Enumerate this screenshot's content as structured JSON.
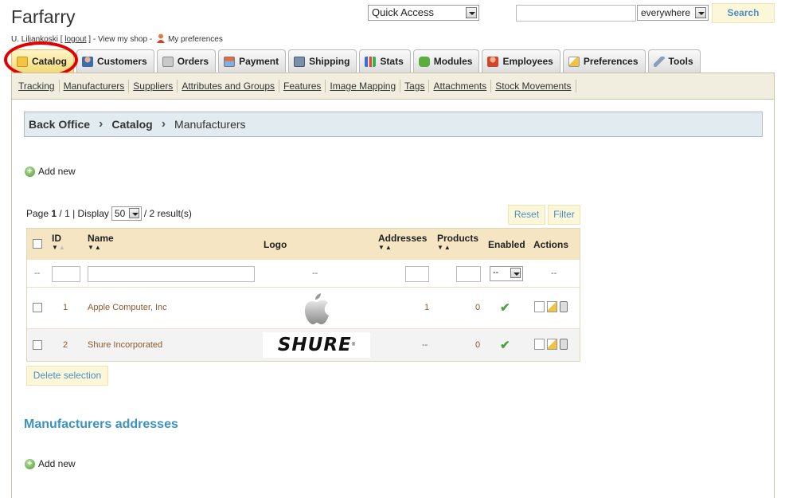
{
  "header": {
    "shop_name": "Farfarry",
    "user": "U. Liljankoski",
    "logout": "logout",
    "view_shop": "View my shop",
    "my_preferences": "My preferences",
    "quick_access": "Quick Access",
    "search_scope": "everywhere",
    "search_label": "Search"
  },
  "tabs": [
    {
      "label": "Catalog",
      "icon": "folder-icon",
      "active": true
    },
    {
      "label": "Customers",
      "icon": "customer-icon"
    },
    {
      "label": "Orders",
      "icon": "cart-icon"
    },
    {
      "label": "Payment",
      "icon": "payment-icon"
    },
    {
      "label": "Shipping",
      "icon": "truck-icon"
    },
    {
      "label": "Stats",
      "icon": "chart-icon"
    },
    {
      "label": "Modules",
      "icon": "puzzle-icon"
    },
    {
      "label": "Employees",
      "icon": "employee-icon"
    },
    {
      "label": "Preferences",
      "icon": "pencil-icon"
    },
    {
      "label": "Tools",
      "icon": "wrench-icon"
    }
  ],
  "subnav": [
    "Tracking",
    "Manufacturers",
    "Suppliers",
    "Attributes and Groups",
    "Features",
    "Image Mapping",
    "Tags",
    "Attachments",
    "Stock Movements"
  ],
  "breadcrumb": [
    "Back Office",
    "Catalog",
    "Manufacturers"
  ],
  "add_new": "Add new",
  "pager": {
    "page_label": "Page",
    "page": "1",
    "total_pages": "/ 1 | Display",
    "display": "50",
    "results": "/ 2 result(s)"
  },
  "buttons": {
    "reset": "Reset",
    "filter": "Filter",
    "delete_selection": "Delete selection"
  },
  "table": {
    "columns": {
      "id": "ID",
      "name": "Name",
      "logo": "Logo",
      "addresses": "Addresses",
      "products": "Products",
      "enabled": "Enabled",
      "actions": "Actions"
    },
    "filter": {
      "dash": "--",
      "enabled_select": "--"
    },
    "rows": [
      {
        "id": "1",
        "name": "Apple Computer, Inc",
        "logo": "apple-logo",
        "addresses": "1",
        "products": "0",
        "enabled": true
      },
      {
        "id": "2",
        "name": "Shure Incorporated",
        "logo": "shure-logo",
        "logo_text": "SHURE",
        "addresses": "--",
        "products": "0",
        "enabled": true
      }
    ]
  },
  "addresses_section": {
    "title": "Manufacturers addresses",
    "add_new": "Add new"
  }
}
